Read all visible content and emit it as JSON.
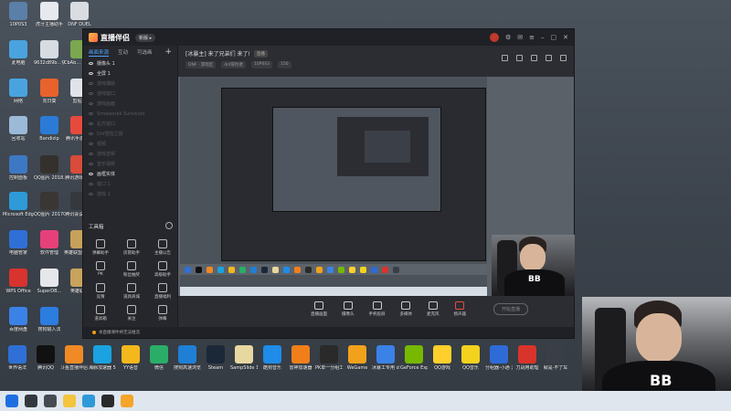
{
  "desktop": {
    "icons": [
      {
        "label": "10P0S3",
        "color": "#5a7fa8"
      },
      {
        "label": "虎牙主播助手",
        "color": "#e6e9ee"
      },
      {
        "label": "DNF DUEL",
        "color": "#d9dde2"
      },
      {
        "label": "此电脑",
        "color": "#4aa3df"
      },
      {
        "label": "9632d89b...快捷方式",
        "color": "#d7dce2"
      },
      {
        "label": "CbAb... 地下城",
        "color": "#7aa84e"
      },
      {
        "label": "网络",
        "color": "#4aa3df"
      },
      {
        "label": "向日葵",
        "color": "#e8622c"
      },
      {
        "label": "剪贴板",
        "color": "#e0e4ea"
      },
      {
        "label": "回收站",
        "color": "#9bbad8"
      },
      {
        "label": "Bandizip",
        "color": "#2b7bd6"
      },
      {
        "label": "腾讯手游助手",
        "color": "#e64a3c"
      },
      {
        "label": "控制面板",
        "color": "#3d78c4"
      },
      {
        "label": "QQ图片 2018...",
        "color": "#34302c"
      },
      {
        "label": "腾讯游戏 全家",
        "color": "#d94b3a"
      },
      {
        "label": "Microsoft Edge",
        "color": "#2e9ad8"
      },
      {
        "label": "QQ图片 20170...",
        "color": "#3a3633"
      },
      {
        "label": "腾讯会议 虚拟",
        "color": "#35383d"
      },
      {
        "label": "电脑管家",
        "color": "#2f6fd6"
      },
      {
        "label": "软件管理",
        "color": "#e6407a"
      },
      {
        "label": "英雄联盟 WeGame",
        "color": "#c7a15a"
      },
      {
        "label": "WPS Office",
        "color": "#d8332e"
      },
      {
        "label": "SuperDB...",
        "color": "#e5e7ea"
      },
      {
        "label": "英雄联盟",
        "color": "#c8a35c"
      },
      {
        "label": "百度网盘",
        "color": "#3b82e6"
      },
      {
        "label": "搜狗输入法",
        "color": "#2b7de0"
      }
    ],
    "dock": [
      {
        "label": "世界语法",
        "color": "#2f6fd6"
      },
      {
        "label": "腾讯QQ",
        "color": "#111111"
      },
      {
        "label": "斗鱼直播伴侣",
        "color": "#f08a24"
      },
      {
        "label": "海豚加速器 5.0",
        "color": "#1aa3e0"
      },
      {
        "label": "YY语音",
        "color": "#f4b81c"
      },
      {
        "label": "微信",
        "color": "#2aae67"
      },
      {
        "label": "搜狗高速浏览器",
        "color": "#1f7fd6"
      },
      {
        "label": "Steam",
        "color": "#1b2838"
      },
      {
        "label": "SampSlide 11",
        "color": "#e7d7a0"
      },
      {
        "label": "酷狗音乐",
        "color": "#1e8ce8"
      },
      {
        "label": "雷神加速器",
        "color": "#f07f1a"
      },
      {
        "label": "PK单一分组工具",
        "color": "#2a2a2a"
      },
      {
        "label": "WeGame",
        "color": "#f2a21a"
      },
      {
        "label": "冰暴工专用 dnf吃鸡计...",
        "color": "#3b82e6"
      },
      {
        "label": "GeForce Experience",
        "color": "#76b900"
      },
      {
        "label": "QQ游戏",
        "color": "#ffcf2b"
      },
      {
        "label": "QQ音乐",
        "color": "#f4d21e"
      },
      {
        "label": "分组器-小通 游子(龙哥)",
        "color": "#2e6bd6"
      },
      {
        "label": "刀战用助理",
        "color": "#d9342b"
      },
      {
        "label": "就是·不了车",
        "color": "#3a3f47"
      }
    ]
  },
  "taskbar": [
    {
      "name": "start",
      "color": "#1d6fe0"
    },
    {
      "name": "search",
      "color": "#33383f"
    },
    {
      "name": "task-view",
      "color": "#454b53"
    },
    {
      "name": "file-explorer",
      "color": "#f3c43c"
    },
    {
      "name": "edge",
      "color": "#2e9ad8"
    },
    {
      "name": "obs",
      "color": "#2a2a2a"
    },
    {
      "name": "huya",
      "color": "#f4a52a"
    }
  ],
  "app": {
    "name": "直播伴侣",
    "badge": "新版 ▸",
    "side_tabs": [
      "画面来源",
      "互动",
      "可选画"
    ],
    "side_tab_active": 0,
    "sources": [
      {
        "label": "摄像头 1",
        "active": true
      },
      {
        "label": "全屏 1",
        "active": true
      },
      {
        "label": "游戏捕获",
        "active": false
      },
      {
        "label": "游戏窗口",
        "active": false
      },
      {
        "label": "游戏画面",
        "active": false
      },
      {
        "label": "Smokestak Survivors",
        "active": false
      },
      {
        "label": "右方窗口",
        "active": false
      },
      {
        "label": "Dnf冒险之旅",
        "active": false
      },
      {
        "label": "视频",
        "active": false
      },
      {
        "label": "游戏音频",
        "active": false
      },
      {
        "label": "音乐视频",
        "active": false
      },
      {
        "label": "画框实体",
        "active": true
      },
      {
        "label": "窗口 1",
        "active": false
      },
      {
        "label": "游戏 1",
        "active": false
      }
    ],
    "toolbox_label": "工具箱",
    "tools": [
      "弹幕助手",
      "房管助手",
      "主播公告",
      "PK",
      "粉丝抽奖",
      "高级助手",
      "竞猜",
      "道具商城",
      "直播福利",
      "道具箱",
      "关注",
      "弹幕"
    ],
    "stream_title": "[冰暴主] 来了兄弟们 来了!",
    "stream_tag": "直播",
    "stream_meta": [
      "DNF · 游戏区",
      "dnf冒险者",
      "10P0S3",
      "150"
    ],
    "controls": [
      {
        "label": "直播画面",
        "red": false
      },
      {
        "label": "摄像头",
        "red": false
      },
      {
        "label": "手机投屏",
        "red": false
      },
      {
        "label": "多媒体",
        "red": false
      },
      {
        "label": "麦克风",
        "red": false
      },
      {
        "label": "扬声器",
        "red": true
      }
    ],
    "start_label": "开始直播",
    "status_text": "本直播课件将无法推流"
  },
  "webcam": {
    "shirt_text": "BB"
  }
}
